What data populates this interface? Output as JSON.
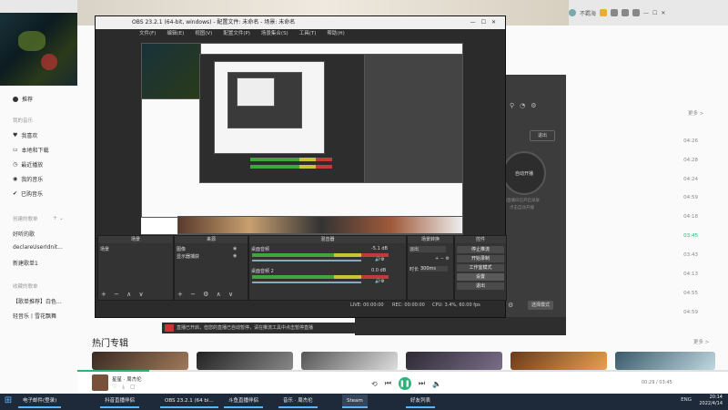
{
  "music": {
    "user_name": "不羁海",
    "sidebar": {
      "home": "推荐",
      "my_music_head": "我的音乐",
      "items": [
        "我喜欢",
        "本地和下载",
        "最近播放",
        "我的音乐",
        "已购音乐"
      ],
      "created_head": "创建的歌单",
      "playlists": [
        "好听的歌",
        "declareUserIdnit...",
        "新建歌单1"
      ],
      "collected_head": "收藏的歌单",
      "collected": [
        "【歌单推荐】白色...",
        "轻音乐丨雪花飘舞"
      ]
    },
    "list_more": "更多 >",
    "times": [
      "04:26",
      "04:28",
      "04:24",
      "04:59",
      "04:18",
      "03:45",
      "03:43",
      "04:13",
      "04:55",
      "04:59"
    ],
    "hot_title": "热门专辑",
    "hot_more": "更多 >",
    "player": {
      "song": "星星 · 周杰伦",
      "time": "00:29 / 03:45",
      "progress": 0.11
    }
  },
  "obs": {
    "title": "OBS 23.2.1 (64-bit, windows) - 配置文件: 未命名 - 场景: 未命名",
    "menu": [
      "文件(F)",
      "编辑(E)",
      "视图(V)",
      "配置文件(P)",
      "场景集合(S)",
      "工具(T)",
      "帮助(H)"
    ],
    "docks": {
      "scenes": {
        "title": "场景",
        "items": [
          "场景"
        ]
      },
      "sources": {
        "title": "来源",
        "items": [
          "图像",
          "显示器捕获"
        ]
      },
      "mixer": {
        "title": "混音器",
        "tracks": [
          {
            "name": "桌面音频",
            "db": "-5.1 dB"
          },
          {
            "name": "桌面音频 2",
            "db": "0.0 dB"
          }
        ]
      },
      "transitions": {
        "title": "场景转换",
        "fade": "淡出",
        "duration_label": "时长",
        "duration": "300ms"
      },
      "controls": {
        "title": "控件",
        "buttons": [
          "停止推流",
          "开始录制",
          "工作室模式",
          "设置",
          "退出"
        ]
      }
    },
    "status": {
      "live": "LIVE: 00:00:00",
      "rec": "REC: 00:00:00",
      "cpu": "CPU: 3.4%, 60.00 fps"
    }
  },
  "right_window": {
    "button_top": "退出",
    "circle_label": "自动开播",
    "text_lines": [
      "当前直播间已开启录屏",
      "点击自动开播"
    ],
    "button_bottom": "选择模式"
  },
  "notification": "直播已开启，但您的直播已自动暂停，请在推流工具中点击暂停直播",
  "taskbar": {
    "items": [
      "电子邮件(登录)",
      "抖音直播伴侣",
      "OBS 23.2.1 (64 bi...",
      "斗鱼直播伴侣",
      "音乐 · 周杰伦",
      "Steam",
      "好友列表"
    ],
    "tray": "ENG",
    "time": "20:14",
    "date": "2022/4/14"
  }
}
